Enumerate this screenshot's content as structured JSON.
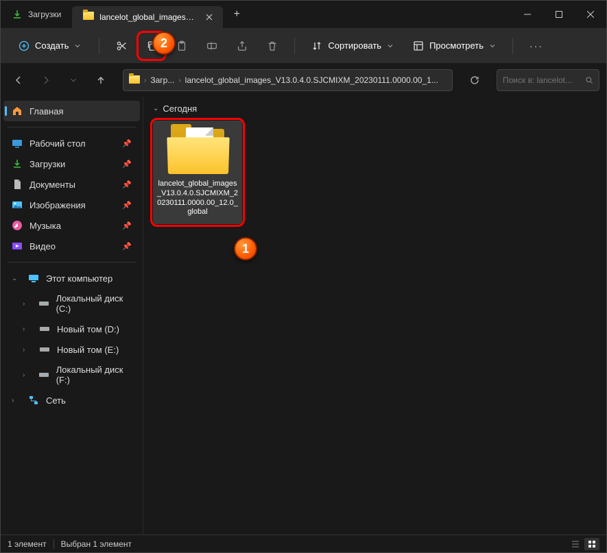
{
  "tabs": {
    "inactive": {
      "label": "Загрузки"
    },
    "active": {
      "label": "lancelot_global_images_V13.0"
    }
  },
  "toolbar": {
    "create": "Создать",
    "sort": "Сортировать",
    "view": "Просмотреть"
  },
  "breadcrumbs": {
    "seg1": "Загр...",
    "seg2": "lancelot_global_images_V13.0.4.0.SJCMIXM_20230111.0000.00_1..."
  },
  "search": {
    "placeholder": "Поиск в: lancelot..."
  },
  "sidebar": {
    "home": "Главная",
    "desktop": "Рабочий стол",
    "downloads": "Загрузки",
    "documents": "Документы",
    "pictures": "Изображения",
    "music": "Музыка",
    "videos": "Видео",
    "thispc": "Этот компьютер",
    "drive_c": "Локальный диск (C:)",
    "drive_d": "Новый том (D:)",
    "drive_e": "Новый том (E:)",
    "drive_f": "Локальный диск (F:)",
    "network": "Сеть"
  },
  "content": {
    "group": "Сегодня",
    "items": [
      {
        "name": "lancelot_global_images_V13.0.4.0.SJCMIXM_20230111.0000.00_12.0_global"
      }
    ]
  },
  "status": {
    "count": "1 элемент",
    "selected": "Выбран 1 элемент"
  },
  "callouts": {
    "one": "1",
    "two": "2"
  }
}
